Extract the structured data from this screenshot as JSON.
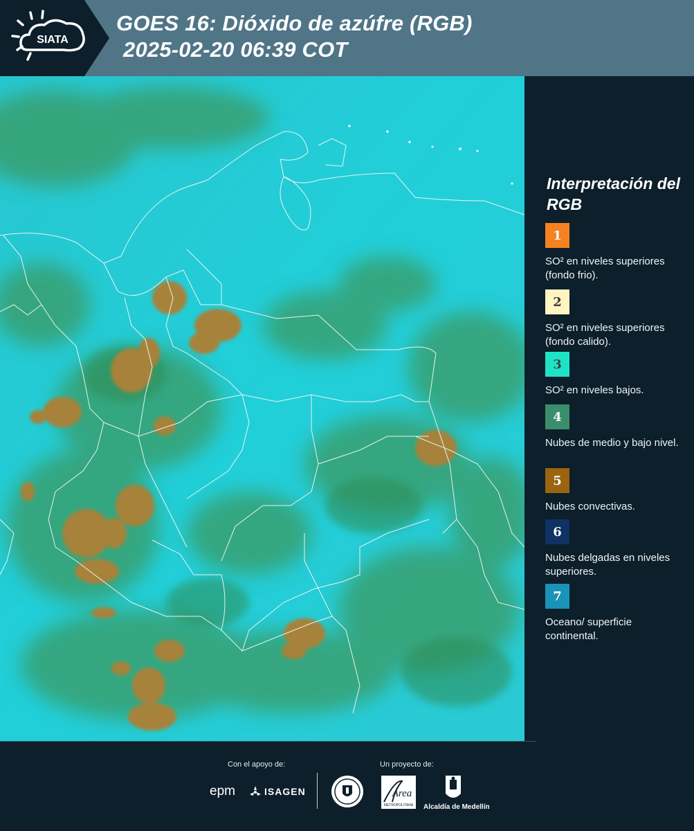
{
  "header": {
    "logo_text": "SIATA",
    "title_line1": "GOES 16: Dióxido de azúfre (RGB)",
    "title_line2": "2025-02-20 06:39 COT"
  },
  "legend": {
    "title": "Interpretación del RGB",
    "items": [
      {
        "number": "1",
        "color": "#f58220",
        "text_color": "#ffffff",
        "label": "SO² en niveles superiores (fondo frio)."
      },
      {
        "number": "2",
        "color": "#fff4c2",
        "text_color": "#3a3a3a",
        "label": "SO² en niveles superiores (fondo calido)."
      },
      {
        "number": "3",
        "color": "#1fe3c6",
        "text_color": "#2a4a45",
        "label": "SO² en niveles bajos."
      },
      {
        "number": "4",
        "color": "#3b8e6b",
        "text_color": "#ffffff",
        "label": "Nubes de medio y bajo nivel."
      },
      {
        "number": "5",
        "color": "#9a6411",
        "text_color": "#ffffff",
        "label": "Nubes convectivas."
      },
      {
        "number": "6",
        "color": "#0f3264",
        "text_color": "#ffffff",
        "label": "Nubes delgadas en niveles superiores."
      },
      {
        "number": "7",
        "color": "#1a93b9",
        "text_color": "#ffffff",
        "label": "Oceano/ superficie continental."
      }
    ]
  },
  "footer": {
    "support_label": "Con el apoyo de:",
    "project_label": "Un proyecto de:",
    "partner_epm": "epm",
    "partner_isagen": "ISAGEN",
    "area_logo_text": "Área",
    "area_logo_subtext": "METROPOLITANA",
    "alcaldia_label": "Alcaldía de Medellín"
  },
  "colors": {
    "header_bg": "#4f7587",
    "panel_bg": "#0c1f2b",
    "map_base": "#1fcbd6",
    "cloud_low": "#3f9a62",
    "cloud_convective": "#a8863a"
  }
}
